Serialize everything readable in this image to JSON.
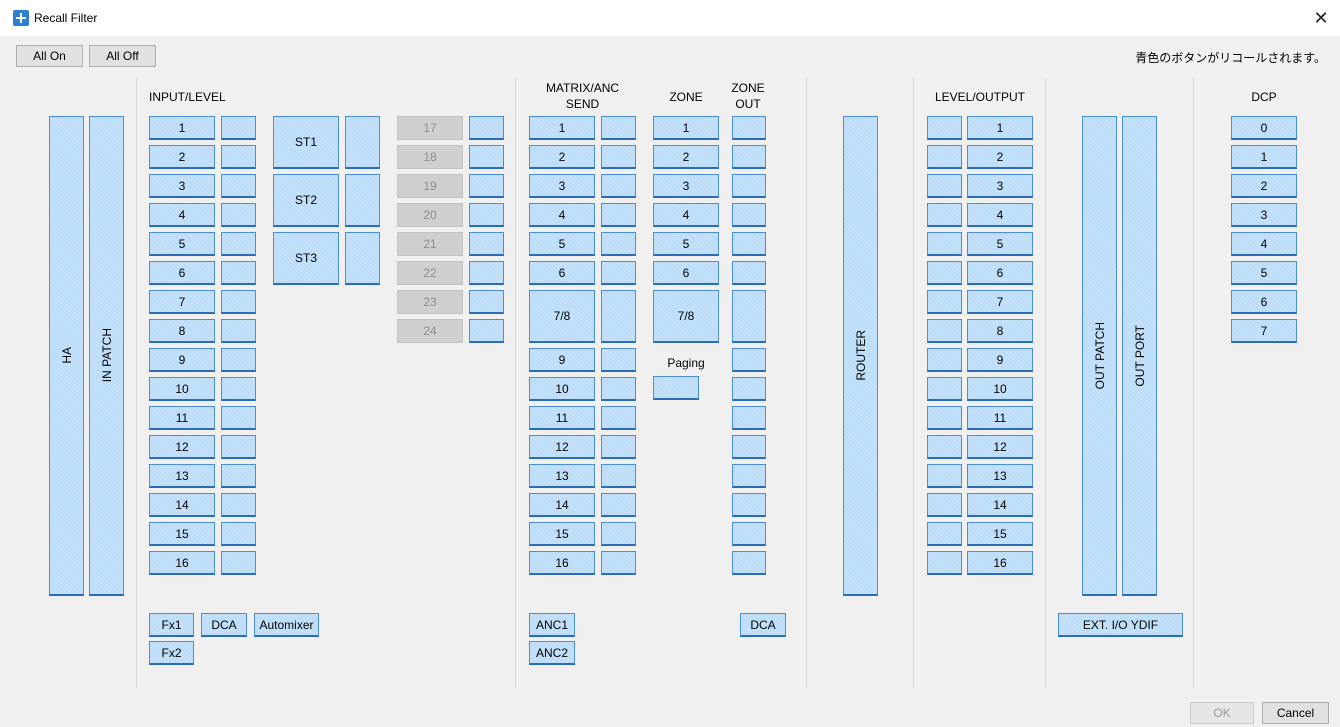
{
  "window": {
    "title": "Recall Filter",
    "close_glyph": "✕"
  },
  "toolbar": {
    "all_on": "All On",
    "all_off": "All Off"
  },
  "note": "青色のボタンがリコールされます。",
  "headers": {
    "input_level": "INPUT/LEVEL",
    "matrix_send": "MATRIX/ANC\nSEND",
    "zone": "ZONE",
    "zone_out": "ZONE\nOUT",
    "level_output": "LEVEL/OUTPUT",
    "dcp": "DCP",
    "paging": "Paging"
  },
  "tall_buttons": {
    "ha": "HA",
    "in_patch": "IN PATCH",
    "router": "ROUTER",
    "out_patch": "OUT PATCH",
    "out_port": "OUT PORT"
  },
  "input_channels": [
    "1",
    "2",
    "3",
    "4",
    "5",
    "6",
    "7",
    "8",
    "9",
    "10",
    "11",
    "12",
    "13",
    "14",
    "15",
    "16"
  ],
  "stereo_channels": [
    "ST1",
    "ST2",
    "ST3"
  ],
  "disabled_channels": [
    "17",
    "18",
    "19",
    "20",
    "21",
    "22",
    "23",
    "24"
  ],
  "matrix_channels": [
    "1",
    "2",
    "3",
    "4",
    "5",
    "6",
    "7/8",
    "9",
    "10",
    "11",
    "12",
    "13",
    "14",
    "15",
    "16"
  ],
  "zone_channels": [
    "1",
    "2",
    "3",
    "4",
    "5",
    "6",
    "7/8"
  ],
  "output_channels": [
    "1",
    "2",
    "3",
    "4",
    "5",
    "6",
    "7",
    "8",
    "9",
    "10",
    "11",
    "12",
    "13",
    "14",
    "15",
    "16"
  ],
  "dcp_channels": [
    "0",
    "1",
    "2",
    "3",
    "4",
    "5",
    "6",
    "7"
  ],
  "bottom": {
    "fx1": "Fx1",
    "fx2": "Fx2",
    "dca": "DCA",
    "automixer": "Automixer",
    "anc1": "ANC1",
    "anc2": "ANC2",
    "zone_dca": "DCA",
    "ext_io": "EXT. I/O YDIF"
  },
  "footer": {
    "ok": "OK",
    "cancel": "Cancel"
  },
  "colors": {
    "button_fill": "#bcdcf8",
    "button_border": "#4a8fd6",
    "disabled_fill": "#cfcfcf"
  }
}
